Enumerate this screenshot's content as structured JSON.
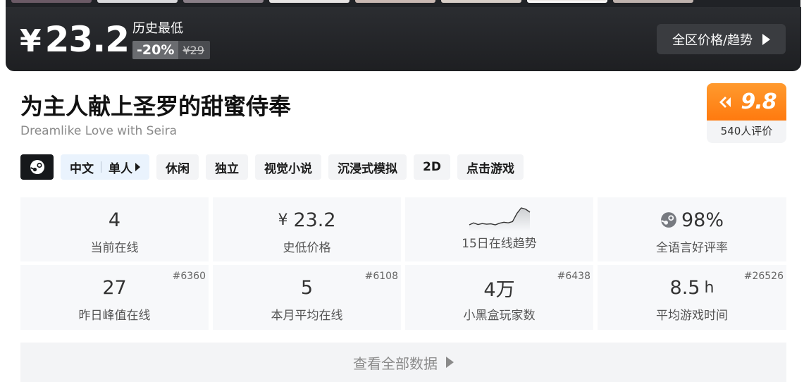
{
  "banner": {
    "currency": "¥",
    "price": "23.2",
    "low_label": "历史最低",
    "discount": "-20%",
    "original_price": "¥29",
    "region_button": "全区价格/趋势"
  },
  "game": {
    "title": "为主人献上圣罗的甜蜜侍奉",
    "subtitle": "Dreamlike Love with Seira"
  },
  "score": {
    "value": "9.8",
    "count": "540人评价"
  },
  "tags": {
    "lang": "中文",
    "player": "单人",
    "items": [
      "休闲",
      "独立",
      "视觉小说",
      "沉浸式模拟",
      "2D",
      "点击游戏"
    ]
  },
  "stats": {
    "online_now": {
      "value": "4",
      "label": "当前在线"
    },
    "lowest_price": {
      "currency": "¥",
      "value": "23.2",
      "label": "史低价格"
    },
    "trend": {
      "label": "15日在线趋势",
      "points": [
        2,
        2.6,
        2.1,
        2.4,
        2.2,
        2.3,
        2.0,
        2.5,
        2.8,
        2.6,
        3.0,
        5.5,
        7.2,
        6.8,
        5.9
      ]
    },
    "rating": {
      "value": "98%",
      "label": "全语言好评率"
    },
    "peak_yesterday": {
      "value": "27",
      "label": "昨日峰值在线",
      "rank": "#6360"
    },
    "month_avg": {
      "value": "5",
      "label": "本月平均在线",
      "rank": "#6108"
    },
    "heybox_players": {
      "value": "4万",
      "label": "小黑盒玩家数",
      "rank": "#6438"
    },
    "avg_playtime": {
      "value": "8.5",
      "unit": "h",
      "label": "平均游戏时间",
      "rank": "#26526"
    }
  },
  "footer": {
    "all_data_button": "查看全部数据"
  },
  "colors": {
    "banner_bg": "#1e1f22",
    "score_orange": "#ff8a1f",
    "tag_bg": "#f3f4f6",
    "lang_tag_bg": "#eaf3fd",
    "stat_bg": "#f7f8fa"
  }
}
